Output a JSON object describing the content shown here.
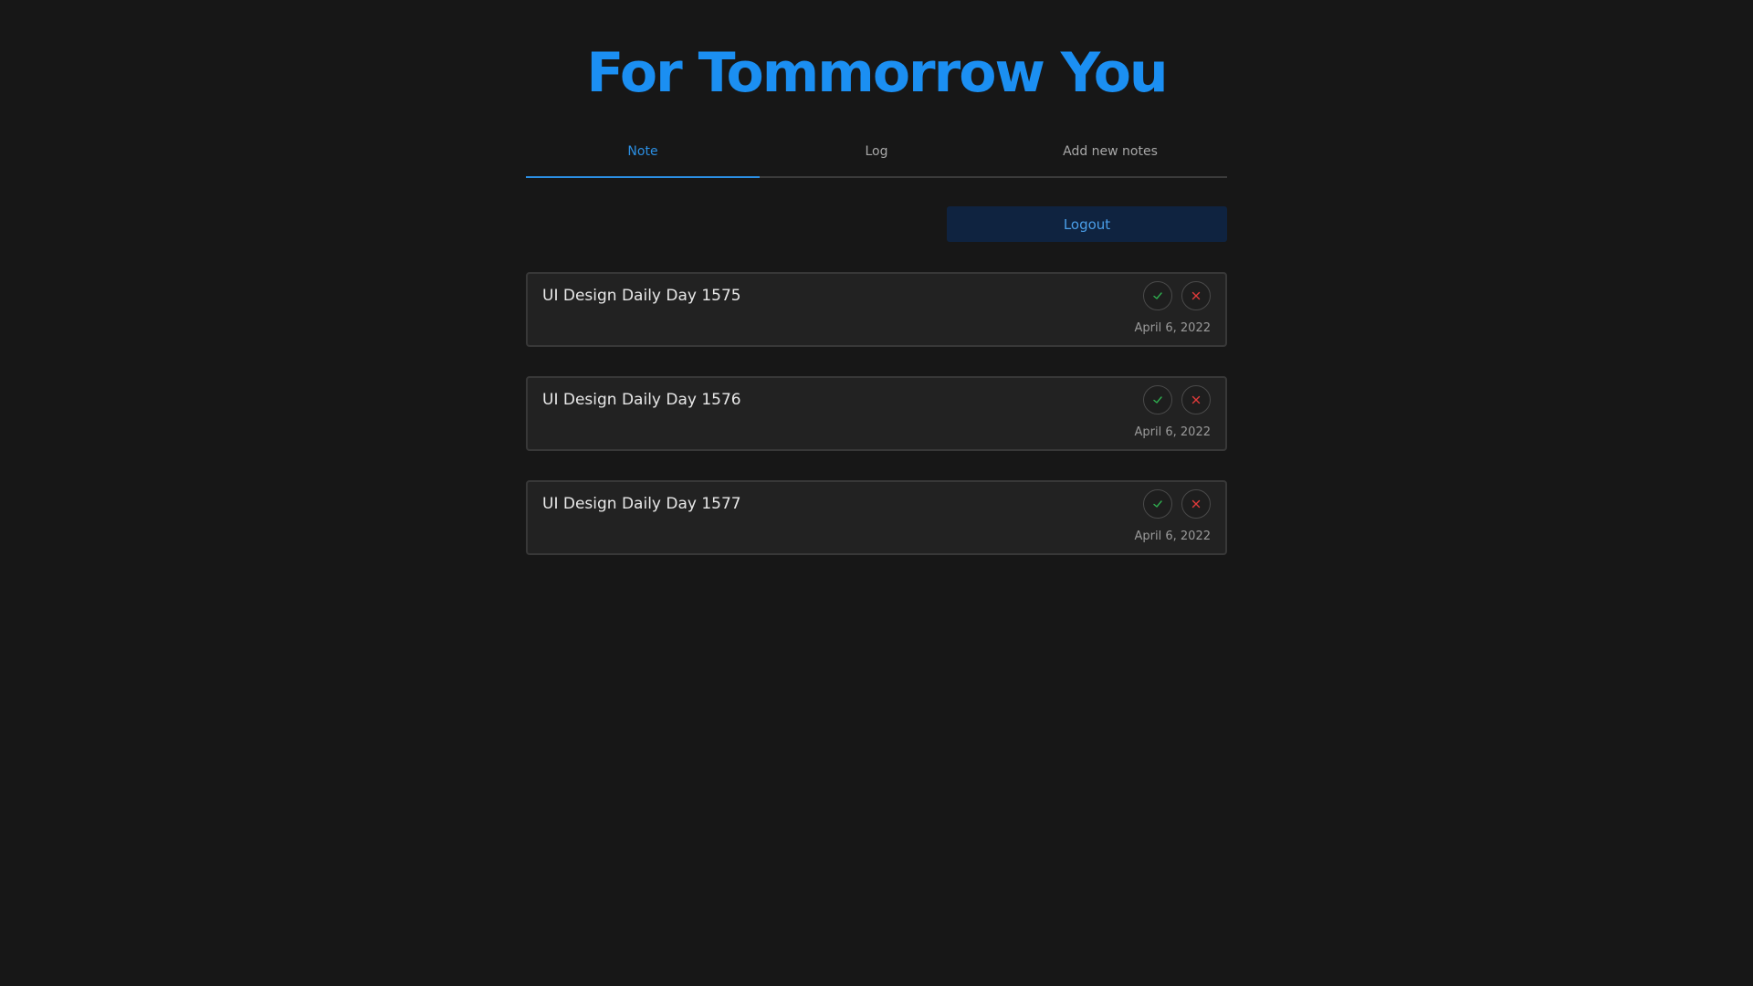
{
  "app": {
    "title": "For Tommorrow You"
  },
  "tabs": [
    {
      "label": "Note",
      "active": true
    },
    {
      "label": "Log",
      "active": false
    },
    {
      "label": "Add new notes",
      "active": false
    }
  ],
  "actions": {
    "logout_label": "Logout"
  },
  "notes": [
    {
      "title": "UI Design Daily Day 1575",
      "date": "April 6, 2022",
      "done_icon": "check-icon",
      "delete_icon": "close-icon"
    },
    {
      "title": "UI Design Daily Day 1576",
      "date": "April 6, 2022",
      "done_icon": "check-icon",
      "delete_icon": "close-icon"
    },
    {
      "title": "UI Design Daily Day 1577",
      "date": "April 6, 2022",
      "done_icon": "check-icon",
      "delete_icon": "close-icon"
    }
  ],
  "colors": {
    "background": "#171717",
    "accent": "#1b8ff2",
    "card": "#222222",
    "check": "#2fae4f",
    "delete": "#e03a3a"
  }
}
